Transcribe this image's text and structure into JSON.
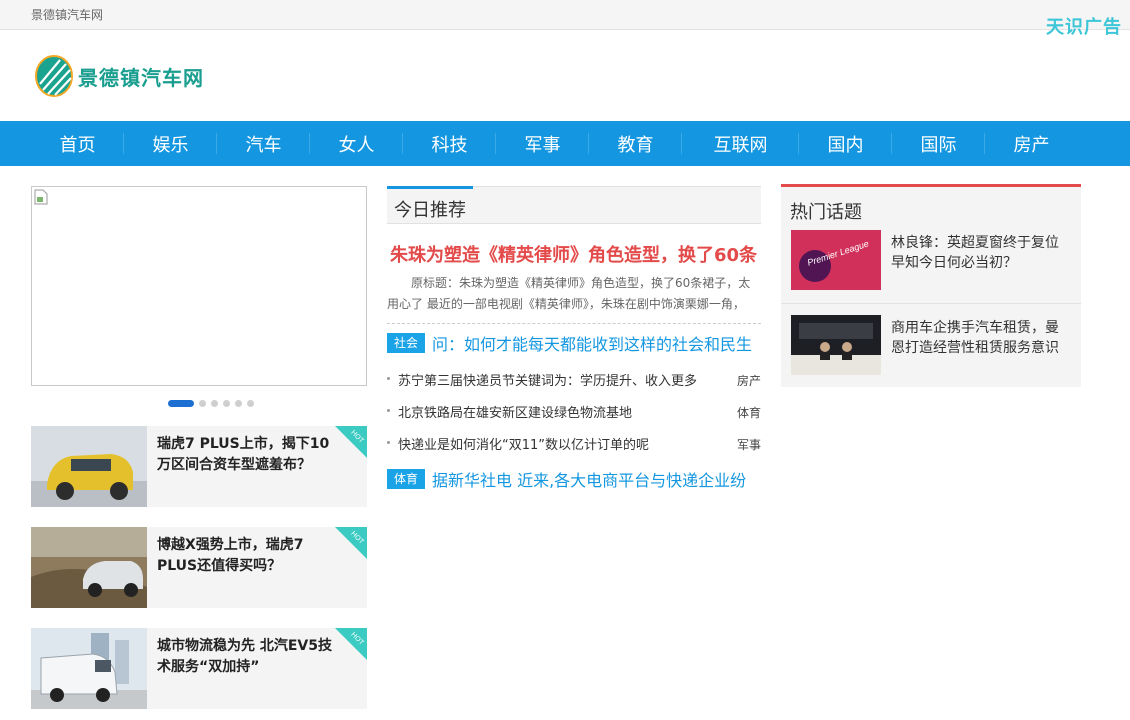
{
  "topbar": {
    "site_name": "景德镇汽车网",
    "ad_label": "天识广告"
  },
  "logo": {
    "text": "景德镇汽车网"
  },
  "nav": [
    "首页",
    "娱乐",
    "汽车",
    "女人",
    "科技",
    "军事",
    "教育",
    "互联网",
    "国内",
    "国际",
    "房产"
  ],
  "slider": {
    "dot_count": 6,
    "active_index": 0
  },
  "cards": [
    {
      "title": "瑞虎7 PLUS上市，揭下10万区间合资车型遮羞布？",
      "badge": "HOT"
    },
    {
      "title": "博越X强势上市，瑞虎7 PLUS还值得买吗？",
      "badge": "HOT"
    },
    {
      "title": "城市物流稳为先 北汽EV5技术服务“双加持”",
      "badge": "HOT"
    }
  ],
  "today": {
    "heading": "今日推荐",
    "headline": "朱珠为塑造《精英律师》角色造型，换了60条",
    "summary": "原标题：朱珠为塑造《精英律师》角色造型，换了60条裙子，太用心了 最近的一部电视剧《精英律师》，朱珠在剧中饰演栗娜一角，",
    "tag1": {
      "tag": "社会",
      "text": "问：如何才能每天都能收到这样的社会和民生"
    },
    "list": [
      {
        "title": "苏宁第三届快递员节关键词为：学历提升、收入更多",
        "category": "房产"
      },
      {
        "title": "北京铁路局在雄安新区建设绿色物流基地",
        "category": "体育"
      },
      {
        "title": "快递业是如何消化“双11”数以亿计订单的呢",
        "category": "军事"
      }
    ],
    "tag2": {
      "tag": "体育",
      "text": "据新华社电 近来,各大电商平台与快递企业纷"
    }
  },
  "hot_topics": {
    "heading": "热门话题",
    "items": [
      {
        "title": "林良锋：英超夏窗终于复位 早知今日何必当初？",
        "image_text": "Premier League"
      },
      {
        "title": "商用车企携手汽车租赁，曼恩打造经营性租赁服务意识"
      }
    ]
  },
  "colors": {
    "nav_bg": "#1497e0",
    "headline": "#e34a4a",
    "accent": "#1aa3e6",
    "hot_badge": "#3ccbc2",
    "ad": "#3cc6d8"
  }
}
